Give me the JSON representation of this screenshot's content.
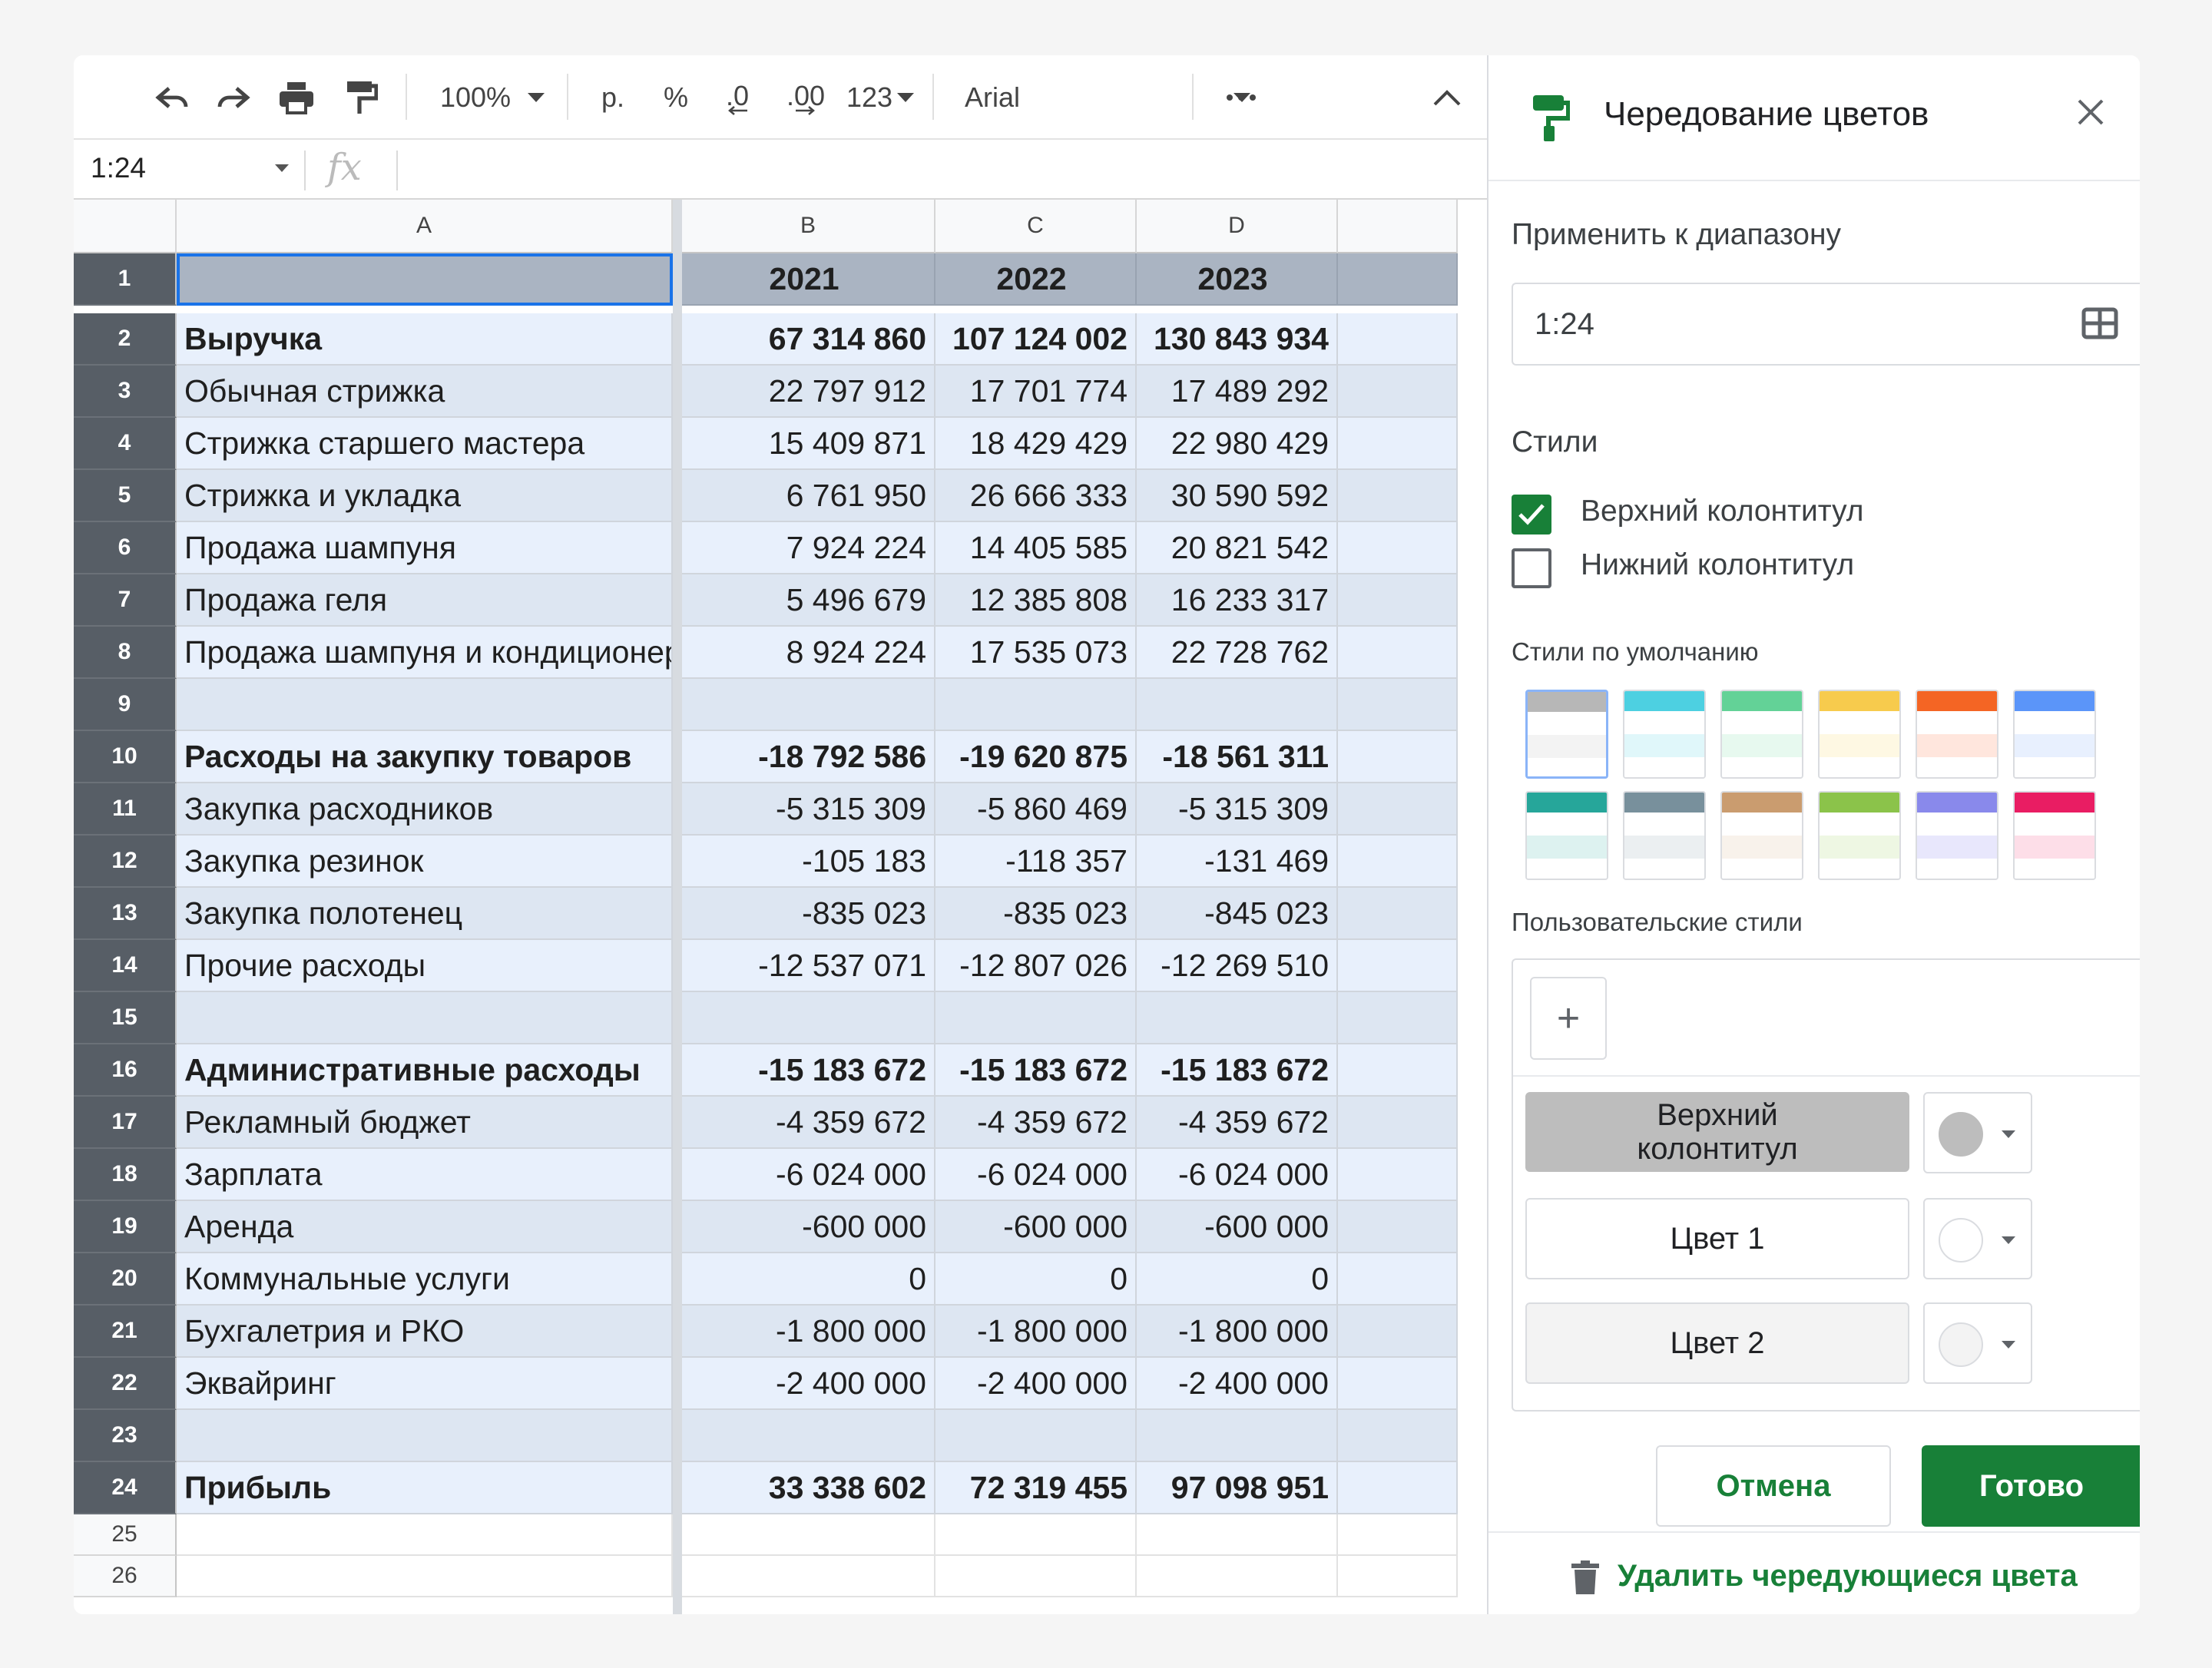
{
  "toolbar": {
    "zoom": "100%",
    "currency": "р.",
    "percent": "%",
    "decrease_decimal": ".0",
    "increase_decimal": ".00",
    "more_formats": "123",
    "font": "Arial",
    "icons": [
      "undo-icon",
      "redo-icon",
      "print-icon",
      "paint-format-icon",
      "more-icon",
      "collapse-icon"
    ]
  },
  "formula_bar": {
    "name_box": "1:24",
    "fx": "fx",
    "formula": ""
  },
  "columns": [
    "A",
    "B",
    "C",
    "D"
  ],
  "rows": [
    {
      "n": "1",
      "style": "hdr",
      "a": "",
      "b": "2021",
      "c": "2022",
      "d": "2023"
    },
    {
      "n": "2",
      "style": "c2 bold",
      "a": "Выручка",
      "b": "67 314 860",
      "c": "107 124 002",
      "d": "130 843 934"
    },
    {
      "n": "3",
      "style": "c1",
      "a": "Обычная стрижка",
      "b": "22 797 912",
      "c": "17 701 774",
      "d": "17 489 292"
    },
    {
      "n": "4",
      "style": "c2",
      "a": "Стрижка старшего мастера",
      "b": "15 409 871",
      "c": "18 429 429",
      "d": "22 980 429"
    },
    {
      "n": "5",
      "style": "c1",
      "a": "Стрижка и укладка",
      "b": "6 761 950",
      "c": "26 666 333",
      "d": "30 590 592"
    },
    {
      "n": "6",
      "style": "c2",
      "a": "Продажа шампуня",
      "b": "7 924 224",
      "c": "14 405 585",
      "d": "20 821 542"
    },
    {
      "n": "7",
      "style": "c1",
      "a": "Продажа геля",
      "b": "5 496 679",
      "c": "12 385 808",
      "d": "16 233 317"
    },
    {
      "n": "8",
      "style": "c2",
      "a": "Продажа шампуня и кондиционера",
      "b": "8 924 224",
      "c": "17 535 073",
      "d": "22 728 762"
    },
    {
      "n": "9",
      "style": "c1",
      "a": "",
      "b": "",
      "c": "",
      "d": ""
    },
    {
      "n": "10",
      "style": "c2 bold",
      "a": "Расходы на закупку товаров",
      "b": "-18 792 586",
      "c": "-19 620 875",
      "d": "-18 561 311"
    },
    {
      "n": "11",
      "style": "c1",
      "a": "Закупка расходников",
      "b": "-5 315 309",
      "c": "-5 860 469",
      "d": "-5 315 309"
    },
    {
      "n": "12",
      "style": "c2",
      "a": "Закупка резинок",
      "b": "-105 183",
      "c": "-118 357",
      "d": "-131 469"
    },
    {
      "n": "13",
      "style": "c1",
      "a": "Закупка полотенец",
      "b": "-835 023",
      "c": "-835 023",
      "d": "-845 023"
    },
    {
      "n": "14",
      "style": "c2",
      "a": "Прочие расходы",
      "b": "-12 537 071",
      "c": "-12 807 026",
      "d": "-12 269 510"
    },
    {
      "n": "15",
      "style": "c1",
      "a": "",
      "b": "",
      "c": "",
      "d": ""
    },
    {
      "n": "16",
      "style": "c2 bold",
      "a": "Административные расходы",
      "b": "-15 183 672",
      "c": "-15 183 672",
      "d": "-15 183 672"
    },
    {
      "n": "17",
      "style": "c1",
      "a": "Рекламный бюджет",
      "b": "-4 359 672",
      "c": "-4 359 672",
      "d": "-4 359 672"
    },
    {
      "n": "18",
      "style": "c2",
      "a": "Зарплата",
      "b": "-6 024 000",
      "c": "-6 024 000",
      "d": "-6 024 000"
    },
    {
      "n": "19",
      "style": "c1",
      "a": "Аренда",
      "b": "-600 000",
      "c": "-600 000",
      "d": "-600 000"
    },
    {
      "n": "20",
      "style": "c2",
      "a": "Коммунальные услуги",
      "b": "0",
      "c": "0",
      "d": "0"
    },
    {
      "n": "21",
      "style": "c1",
      "a": "Бухгалетрия и РКО",
      "b": "-1 800 000",
      "c": "-1 800 000",
      "d": "-1 800 000"
    },
    {
      "n": "22",
      "style": "c2",
      "a": "Эквайринг",
      "b": "-2 400 000",
      "c": "-2 400 000",
      "d": "-2 400 000"
    },
    {
      "n": "23",
      "style": "c1",
      "a": "",
      "b": "",
      "c": "",
      "d": ""
    },
    {
      "n": "24",
      "style": "c2 bold",
      "a": "Прибыль",
      "b": "33 338 602",
      "c": "72 319 455",
      "d": "97 098 951"
    },
    {
      "n": "25",
      "style": "plain",
      "a": "",
      "b": "",
      "c": "",
      "d": ""
    },
    {
      "n": "26",
      "style": "plain",
      "a": "",
      "b": "",
      "c": "",
      "d": ""
    }
  ],
  "panel": {
    "title": "Чередование цветов",
    "apply_range_label": "Применить к диапазону",
    "range_value": "1:24",
    "styles_label": "Стили",
    "header_checkbox": {
      "label": "Верхний колонтитул",
      "checked": true
    },
    "footer_checkbox": {
      "label": "Нижний колонтитул",
      "checked": false
    },
    "default_styles_label": "Стили по умолчанию",
    "default_styles": [
      {
        "header": "#b7b7b7",
        "alt": "#f3f3f3"
      },
      {
        "header": "#4dd0e1",
        "alt": "#e0f7fa"
      },
      {
        "header": "#63d297",
        "alt": "#e7f9ef"
      },
      {
        "header": "#f7cb4d",
        "alt": "#fef8e3"
      },
      {
        "header": "#f46524",
        "alt": "#ffe6dd"
      },
      {
        "header": "#5b95f9",
        "alt": "#e8f0fe"
      },
      {
        "header": "#26a69a",
        "alt": "#ddf2f0"
      },
      {
        "header": "#78909c",
        "alt": "#ebeff1"
      },
      {
        "header": "#ca9c6f",
        "alt": "#f8f2eb"
      },
      {
        "header": "#8bc34a",
        "alt": "#eef7e3"
      },
      {
        "header": "#8989eb",
        "alt": "#e8e7fc"
      },
      {
        "header": "#e91d63",
        "alt": "#fddee8"
      }
    ],
    "custom_styles_label": "Пользовательские стили",
    "add_label": "+",
    "roles": [
      {
        "label": "Верхний колонтитул",
        "color": "#bdbdbd"
      },
      {
        "label": "Цвет 1",
        "color": "#ffffff"
      },
      {
        "label": "Цвет 2",
        "color": "#f3f3f3"
      }
    ],
    "cancel_label": "Отмена",
    "done_label": "Готово",
    "delete_label": "Удалить чередующиеся цвета"
  },
  "colors": {
    "accent": "#188038",
    "selection": "#1a73e8",
    "header_band": "#aab4c2"
  }
}
